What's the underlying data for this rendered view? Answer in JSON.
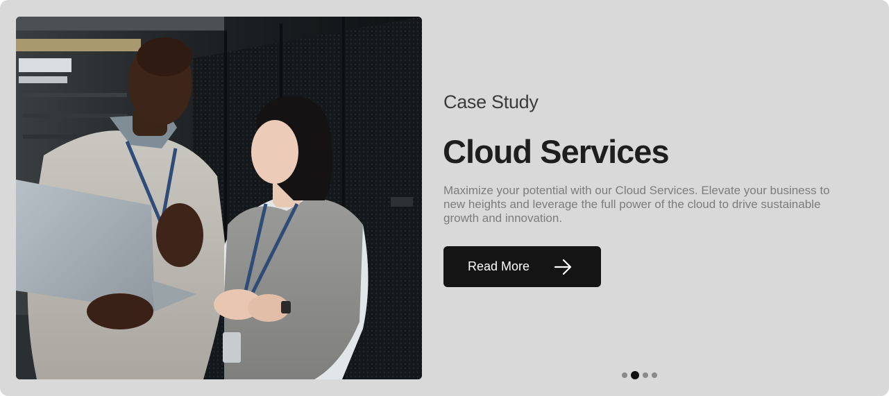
{
  "slide": {
    "eyebrow": "Case Study",
    "title": "Cloud Services",
    "description": "Maximize your potential with our Cloud Services. Elevate your business to new heights and leverage the full power of the cloud to drive sustainable growth and innovation.",
    "cta": {
      "label": "Read More",
      "icon": "arrow-right-icon"
    },
    "image": {
      "subject": "two people in a server room reviewing a laptop"
    }
  },
  "pager": {
    "total": 4,
    "active_index": 1
  },
  "colors": {
    "card_background": "#d9d9d9",
    "title": "#1e1e1e",
    "body_text": "#7c7c7c",
    "button": "#141414",
    "button_text": "#ffffff",
    "dot_active": "#111111",
    "dot_inactive": "#8a8a8a"
  }
}
